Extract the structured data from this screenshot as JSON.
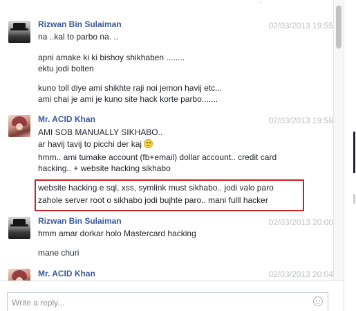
{
  "conversation": {
    "messages": [
      {
        "author": "Rizwan Bin Sulaiman",
        "timestamp": "02/03/2013 19:55",
        "avatar_icon": "fedora-man-avatar",
        "lines": [
          "na ..kal to parbo na. ..",
          "apni amake ki ki bishoy shikhaben ........",
          "ektu jodi bolten",
          "kuno toll diye ami shikhte raji noi jemon havij etc...",
          "ami chai je ami je kuno site hack korte parbo......."
        ]
      },
      {
        "author": "Mr. ACID Khan",
        "timestamp": "02/03/2013 19:58",
        "avatar_icon": "anime-girl-avatar",
        "lines": [
          "AMI SOB MANUALLY SIKHABO..",
          "ar havij tavij to picchi der kaj",
          "hmm.. ami tumake account (fb+email) dollar account.. credit card",
          "hacking.. + website hacking sikhabo",
          "website hacking e sql, xss, symlink must sikhabo.. jodi valo paro",
          "zahole server root o sikhabo jodi bujhte paro.. mani fulll hacker"
        ]
      },
      {
        "author": "Rizwan Bin Sulaiman",
        "timestamp": "02/03/2013 20:00",
        "avatar_icon": "fedora-man-avatar",
        "lines": [
          "hmm amar dorkar holo Mastercard hacking",
          "mane churi"
        ]
      },
      {
        "author": "Mr. ACID Khan",
        "timestamp": "02/03/2013 20:04",
        "avatar_icon": "anime-girl-avatar",
        "lines": []
      }
    ]
  },
  "composer": {
    "placeholder": "Write a reply...",
    "emoji_icon": "smiley-icon"
  },
  "colors": {
    "author_link": "#3b5998",
    "timestamp": "#bcc0c4",
    "highlight_border": "#d11f22"
  }
}
